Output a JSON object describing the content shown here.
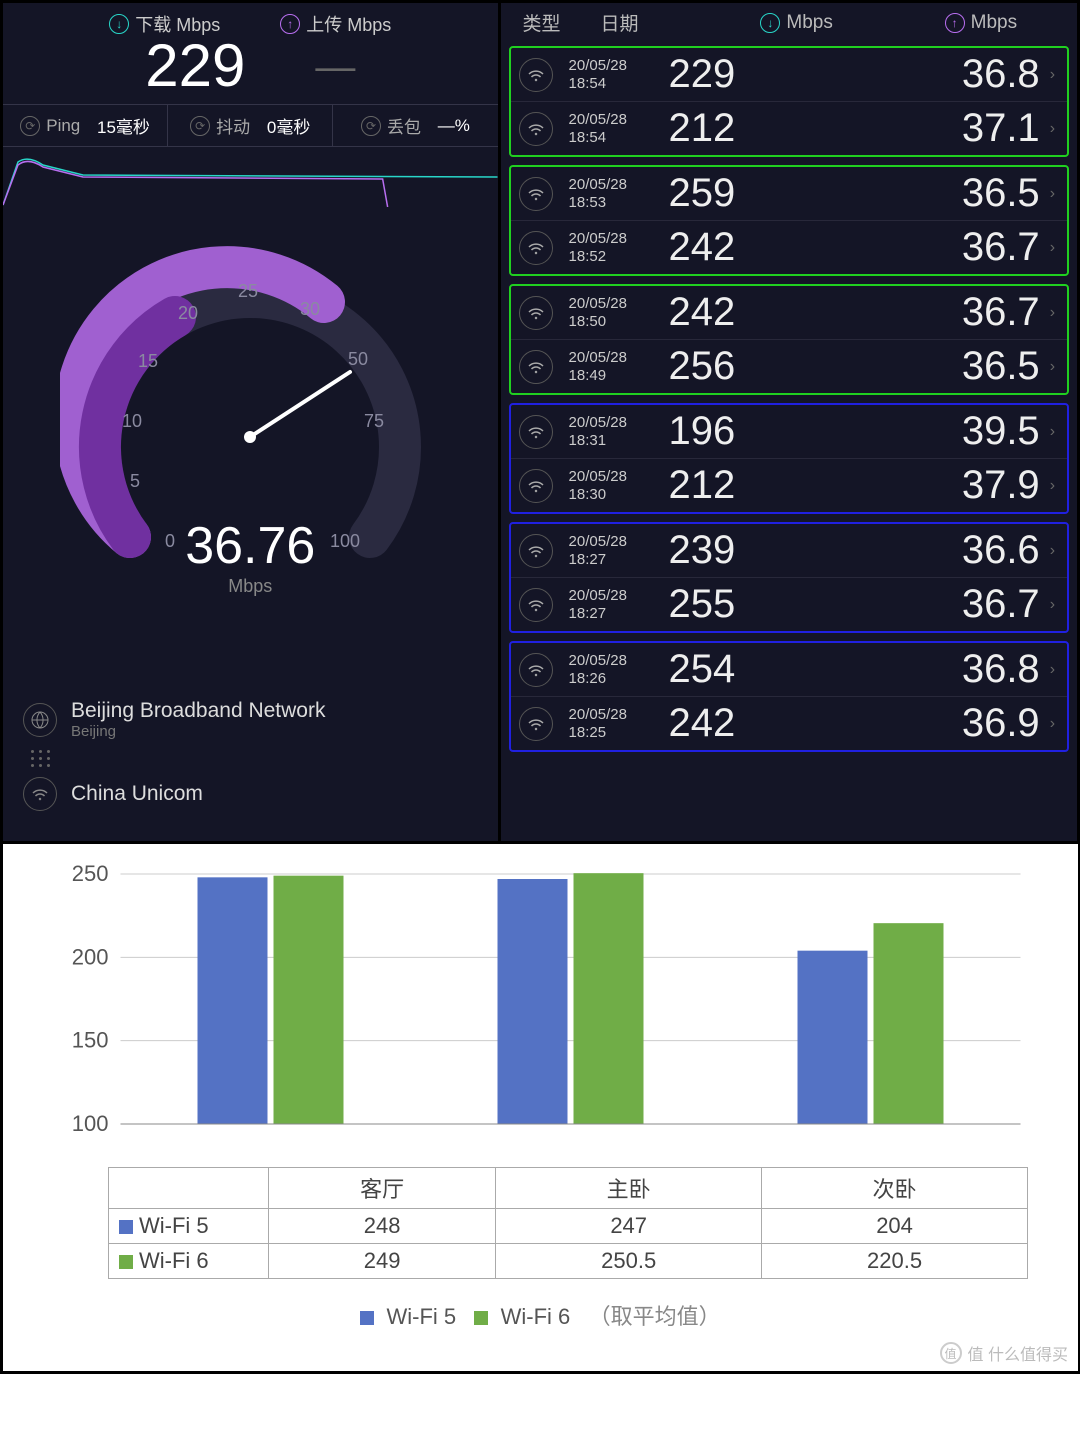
{
  "speedtest": {
    "header": {
      "download_label": "下载 Mbps",
      "upload_label": "上传 Mbps",
      "download_value": "229",
      "upload_value": "—"
    },
    "stats": {
      "ping_label": "Ping",
      "ping_value": "15毫秒",
      "jitter_label": "抖动",
      "jitter_value": "0毫秒",
      "loss_label": "丢包",
      "loss_value": "—%"
    },
    "gauge": {
      "ticks": [
        "0",
        "5",
        "10",
        "15",
        "20",
        "25",
        "30",
        "50",
        "75",
        "100"
      ],
      "center_value": "36.76",
      "center_unit": "Mbps"
    },
    "footer": {
      "isp_name": "Beijing Broadband Network",
      "isp_loc": "Beijing",
      "server_name": "China Unicom"
    }
  },
  "history": {
    "header": {
      "type": "类型",
      "date": "日期",
      "dl": "Mbps",
      "ul": "Mbps"
    },
    "groups": [
      {
        "color": "green",
        "rows": [
          {
            "date": "20/05/28",
            "time": "18:54",
            "dl": "229",
            "ul": "36.8"
          },
          {
            "date": "20/05/28",
            "time": "18:54",
            "dl": "212",
            "ul": "37.1"
          }
        ]
      },
      {
        "color": "green",
        "rows": [
          {
            "date": "20/05/28",
            "time": "18:53",
            "dl": "259",
            "ul": "36.5"
          },
          {
            "date": "20/05/28",
            "time": "18:52",
            "dl": "242",
            "ul": "36.7"
          }
        ]
      },
      {
        "color": "green",
        "rows": [
          {
            "date": "20/05/28",
            "time": "18:50",
            "dl": "242",
            "ul": "36.7"
          },
          {
            "date": "20/05/28",
            "time": "18:49",
            "dl": "256",
            "ul": "36.5"
          }
        ]
      },
      {
        "color": "blue",
        "rows": [
          {
            "date": "20/05/28",
            "time": "18:31",
            "dl": "196",
            "ul": "39.5"
          },
          {
            "date": "20/05/28",
            "time": "18:30",
            "dl": "212",
            "ul": "37.9"
          }
        ]
      },
      {
        "color": "blue",
        "rows": [
          {
            "date": "20/05/28",
            "time": "18:27",
            "dl": "239",
            "ul": "36.6"
          },
          {
            "date": "20/05/28",
            "time": "18:27",
            "dl": "255",
            "ul": "36.7"
          }
        ]
      },
      {
        "color": "blue",
        "rows": [
          {
            "date": "20/05/28",
            "time": "18:26",
            "dl": "254",
            "ul": "36.8"
          },
          {
            "date": "20/05/28",
            "time": "18:25",
            "dl": "242",
            "ul": "36.9"
          }
        ]
      }
    ]
  },
  "chart_data": {
    "type": "bar",
    "categories": [
      "客厅",
      "主卧",
      "次卧"
    ],
    "series": [
      {
        "name": "Wi-Fi 5",
        "color": "#5472c4",
        "values": [
          248,
          247,
          204
        ]
      },
      {
        "name": "Wi-Fi 6",
        "color": "#70ad47",
        "values": [
          249,
          250.5,
          220.5
        ]
      }
    ],
    "ylim": [
      100,
      250
    ],
    "yticks": [
      100,
      150,
      200,
      250
    ],
    "legend_note": "（取平均值）"
  },
  "watermark": "值  什么值得买"
}
